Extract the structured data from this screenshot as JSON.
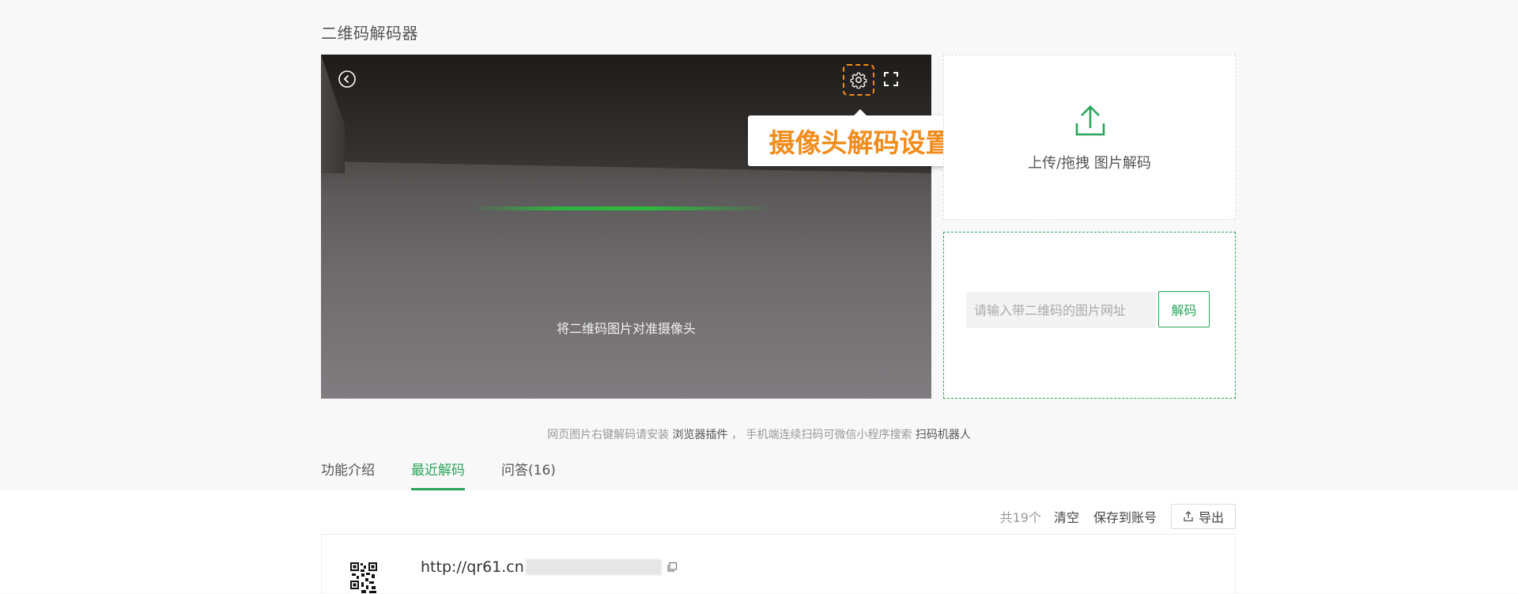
{
  "page": {
    "title": "二维码解码器"
  },
  "camera": {
    "hint": "将二维码图片对准摄像头"
  },
  "tooltip": {
    "text": "摄像头解码设置"
  },
  "upload": {
    "label": "上传/拖拽 图片解码"
  },
  "url_decode": {
    "placeholder": "请输入带二维码的图片网址",
    "button": "解码"
  },
  "install_tip": {
    "prefix": "网页图片右键解码请安装",
    "link1": "浏览器插件",
    "middle": "，  手机端连续扫码可微信小程序搜索",
    "link2": "扫码机器人"
  },
  "tabs": [
    {
      "label": "功能介绍",
      "active": false
    },
    {
      "label": "最近解码",
      "active": true
    },
    {
      "label": "问答(16)",
      "active": false
    }
  ],
  "toolbar": {
    "count": "共19个",
    "clear": "清空",
    "save": "保存到账号",
    "export": "导出"
  },
  "records": [
    {
      "url_visible": "http://qr61.cn"
    }
  ],
  "colors": {
    "accent": "#2aa55b",
    "highlight": "#f08c1c"
  }
}
